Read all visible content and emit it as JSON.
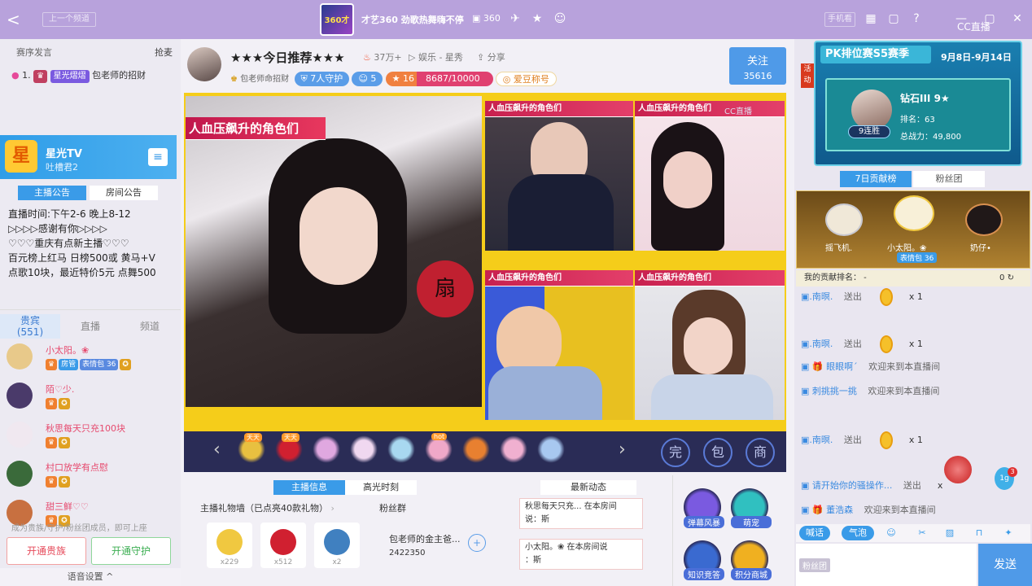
{
  "topbar": {
    "back_label": "<",
    "prev_tag": "上一个频道",
    "logo_text": "360才艺",
    "room_title": "才艺360 劲歌热舞嗨不停",
    "room_number": "360",
    "phone_btn": "手机看",
    "cc_logo": "CC直播"
  },
  "left": {
    "greet_label": "赛序发言",
    "grab_label": "抢麦",
    "rank_no": "1.",
    "rank_badge": "星光熠熠",
    "rank_name": "包老师的招财",
    "anchor_name": "星光TV",
    "anchor_sub": "吐槽君2",
    "notice_tabs": [
      "主播公告",
      "房间公告"
    ],
    "notice_text": "直播时间:下午2-6 晚上8-12\n▷▷▷▷感谢有你▷▷▷▷\n♡♡♡重庆有点新主播♡♡♡\n百元榜上红马 日榜500或 黄马+V\n点歌10块，最近特价5元  点舞500",
    "user_tabs": [
      "贵宾\n(551)",
      "直播",
      "频道"
    ],
    "users": [
      {
        "name": "小太阳。❀",
        "badges": [
          "房管",
          "表情包 36"
        ],
        "color": "#e8c98a"
      },
      {
        "name": "陌♡少.",
        "badges": [],
        "color": "#4a3a6a"
      },
      {
        "name": "秋思每天只充100块",
        "badges": [],
        "color": "#f0e8f0"
      },
      {
        "name": "村口放学有点慰",
        "badges": [],
        "color": "#3a6a3a"
      },
      {
        "name": "甜三鲜♡♡",
        "badges": [],
        "color": "#c87040"
      }
    ],
    "tip": "成为贵族/守护/粉丝团成员，即可上座",
    "btn_noble": "开通贵族",
    "btn_guard": "开通守护",
    "voice_settings": "语音设置 ^"
  },
  "center": {
    "room_name": "★★★今日推荐★★★",
    "fire_count": "37万+",
    "category": "娱乐 - 星秀",
    "share": "分享",
    "host_name": "包老师命招财",
    "guard_pill": "7人守护",
    "fans_pill": "5",
    "level": "16",
    "exp": "8687/10000",
    "love_pill": "爱豆称号",
    "follow_label": "关注",
    "follow_count": "35616",
    "banner_text": "人血压飙升的角色们",
    "panel_banner": "人血压飙升的角色们",
    "watermark": "CC直播",
    "gift_tags": [
      "天天",
      "天天",
      "",
      "",
      "",
      "hot"
    ],
    "gift_colors": [
      "#e8c040",
      "#d02030",
      "#e0a8e0",
      "#f0d8f0",
      "#a8d8f0",
      "#f0a8c8",
      "#e88030",
      "#f0b0d0",
      "#a8c8f0"
    ],
    "hint_icons": [
      "完",
      "包",
      "商"
    ],
    "bottom_tabs": [
      "主播信息",
      "高光时刻"
    ],
    "gift_wall_title": "主播礼物墙（已点亮40款礼物）",
    "fan_module": "粉丝群",
    "wall_gifts": [
      {
        "count": "x229",
        "color": "#f0c840"
      },
      {
        "count": "x512",
        "color": "#d02030"
      },
      {
        "count": "x2",
        "color": "#4080c0"
      }
    ],
    "gold_title": "包老师的金主爸...",
    "gold_num": "2422350",
    "news_tab": "最新动态",
    "news": [
      {
        "line1": "秋思每天只充...   在本房间",
        "line2": "说：斯"
      },
      {
        "line1": "小太阳。❀   在本房间说",
        "line2": "：斯"
      }
    ],
    "features": [
      {
        "label": "弹幕风暴",
        "color": "#7a5ae0"
      },
      {
        "label": "萌宠",
        "color": "#30c0c0"
      },
      {
        "label": "知识竞答",
        "color": "#3a6ad0"
      },
      {
        "label": "积分商城",
        "color": "#f0b020"
      }
    ]
  },
  "right": {
    "pk_title": "PK排位赛S5赛季",
    "pk_date": "9月8日-9月14日",
    "pk_hidden": "活动",
    "pk_win": "9连胜",
    "pk_rank": "钻石III  9★",
    "pk_position": "排名：63",
    "pk_power": "总战力：49,800",
    "tabs": [
      "7日贡献榜",
      "粉丝团"
    ],
    "contributors": [
      "摇飞机.",
      "小太阳。❀",
      "奶仔•"
    ],
    "contrib_badge": "表情包 36",
    "my_rank_label": "我的贡献排名：   -",
    "my_rank_value": "0",
    "chat": [
      {
        "name": "▣.南暝.",
        "msg": "送出",
        "qty": "x 1",
        "coin": true
      },
      {
        "name": "▣.南暝.",
        "msg": "送出",
        "qty": "x 1",
        "coin": true
      },
      {
        "name": "▣ 🎁 眼眼啊´",
        "msg": "欢迎来到本直播间",
        "qty": "",
        "coin": false
      },
      {
        "name": "▣ 刺挑挑一挑",
        "msg": "欢迎来到本直播间",
        "qty": "",
        "coin": false
      },
      {
        "name": "▣.南暝.",
        "msg": "送出",
        "qty": "x 1",
        "coin": true
      },
      {
        "name": "▣ 请开始你的骚操作...",
        "msg": "送出",
        "qty": "x",
        "coin": false
      },
      {
        "name": "▣ 🎁 董浩森",
        "msg": "欢迎来到本直播间",
        "qty": "",
        "coin": false
      }
    ],
    "tools": [
      "喊话",
      "气泡"
    ],
    "fan_label": "粉丝团",
    "send_label": "发送"
  }
}
